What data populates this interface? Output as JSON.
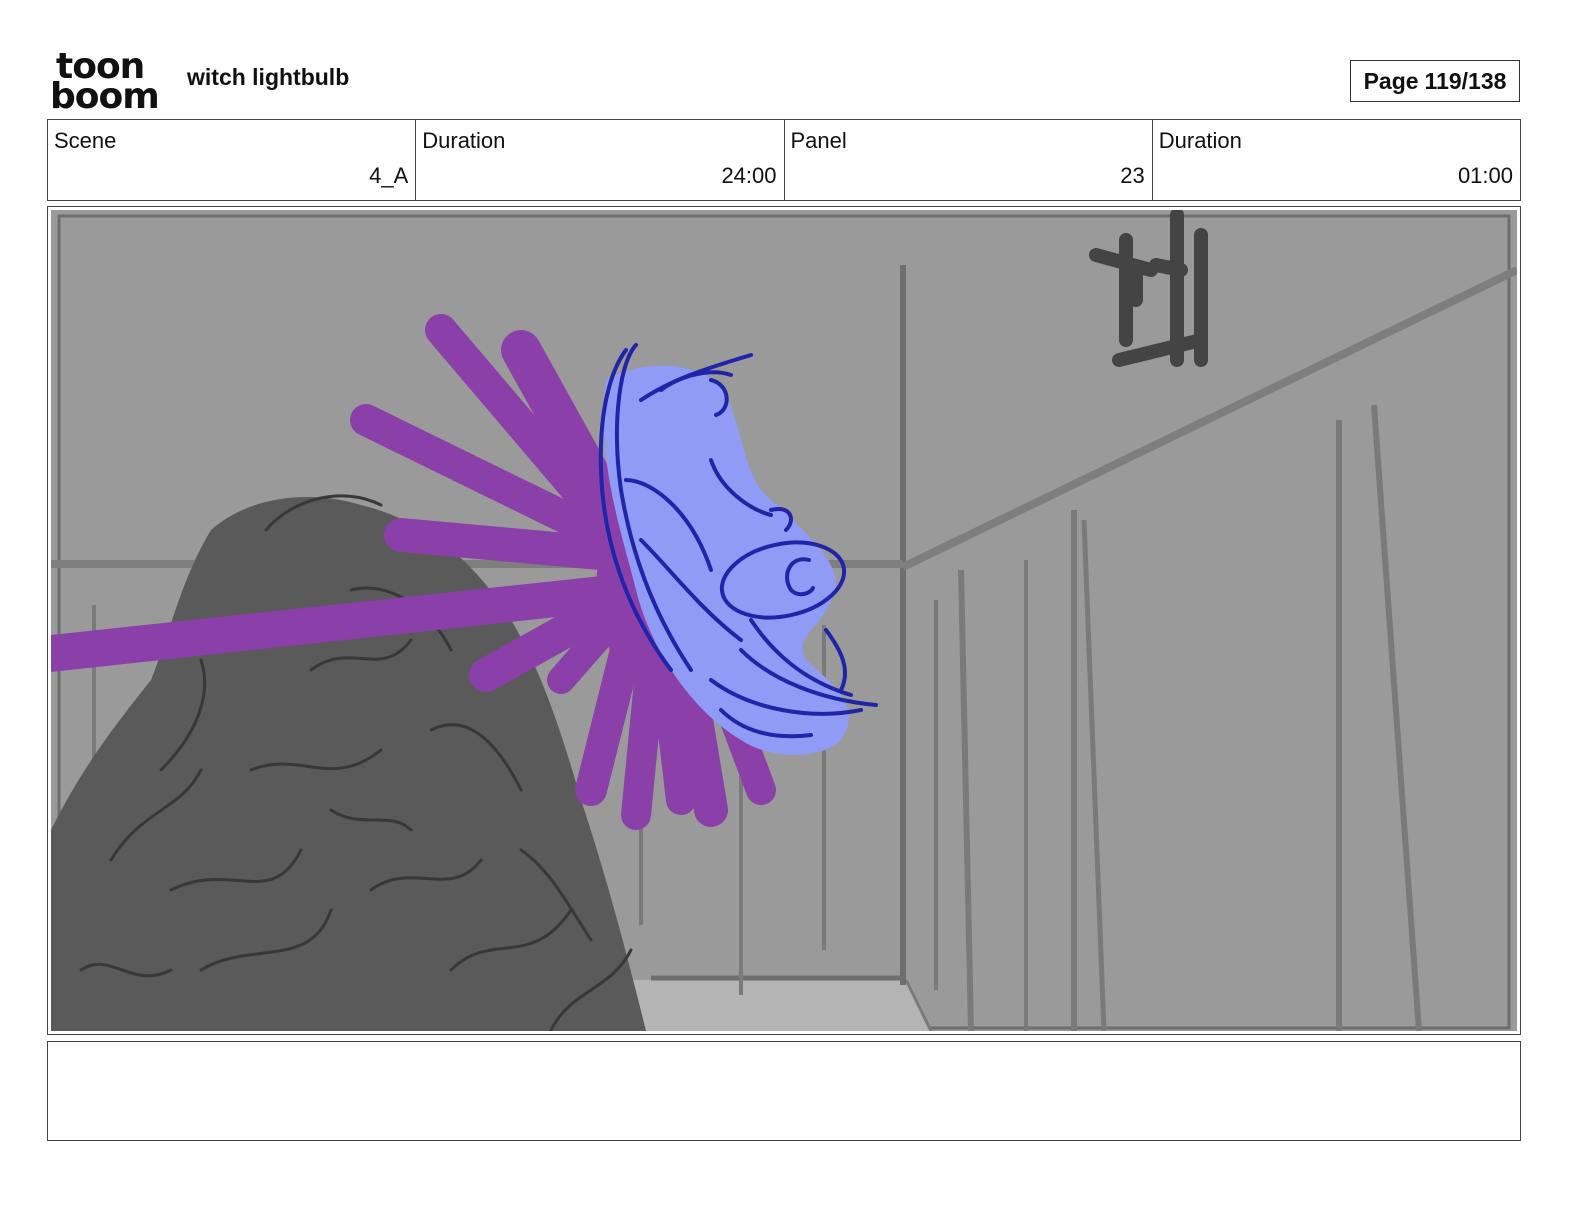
{
  "header": {
    "logo_top": "toon",
    "logo_bottom": "boom",
    "project_title": "witch lightbulb",
    "page_label": "Page",
    "page_value": "119/138"
  },
  "info": {
    "scene_label": "Scene",
    "scene_value": "4_A",
    "scene_duration_label": "Duration",
    "scene_duration_value": "24:00",
    "panel_label": "Panel",
    "panel_value": "23",
    "panel_duration_label": "Duration",
    "panel_duration_value": "01:00"
  },
  "drawing": {
    "background_color": "#9a9a9a",
    "figure_color": "#5a5a5a",
    "beam_color": "#8b3fa8",
    "head_fill_color": "#8f9bf5",
    "head_line_color": "#2024a8",
    "head_letter": "C"
  },
  "notes": {
    "text": ""
  }
}
